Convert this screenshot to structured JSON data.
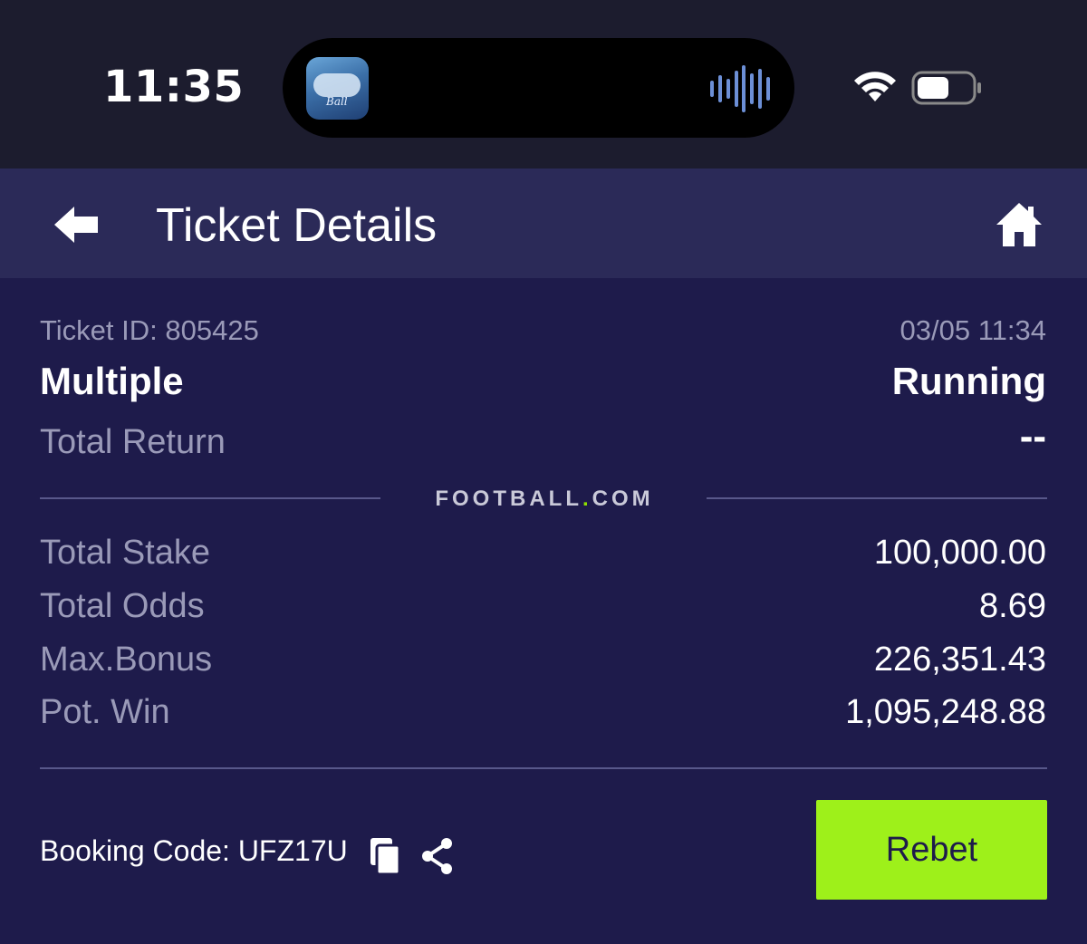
{
  "status_bar": {
    "time": "11:35",
    "app_thumb_text": "Ball"
  },
  "header": {
    "title": "Ticket Details",
    "back_icon": "arrow-left-icon",
    "home_icon": "home-icon"
  },
  "ticket": {
    "id_text": "Ticket ID: 805425",
    "datetime": "03/05 11:34",
    "type": "Multiple",
    "status": "Running",
    "total_return_label": "Total Return",
    "total_return_value": "--"
  },
  "brand": {
    "left": "FOOTBALL",
    "dot": ".",
    "right": "COM",
    "dot_color": "#8ee000"
  },
  "summary": [
    {
      "label": "Total Stake",
      "value": "100,000.00"
    },
    {
      "label": "Total Odds",
      "value": "8.69"
    },
    {
      "label": "Max.Bonus",
      "value": "226,351.43"
    },
    {
      "label": "Pot. Win",
      "value": "1,095,248.88"
    }
  ],
  "footer": {
    "booking_code": "Booking Code: UFZ17U",
    "copy_icon": "copy-icon",
    "share_icon": "share-icon",
    "rebet_label": "Rebet",
    "rebet_color": "#9ef01a"
  },
  "colors": {
    "background": "#1e1b4b",
    "header": "#2b2a58",
    "muted_text": "#9a9ab8"
  }
}
